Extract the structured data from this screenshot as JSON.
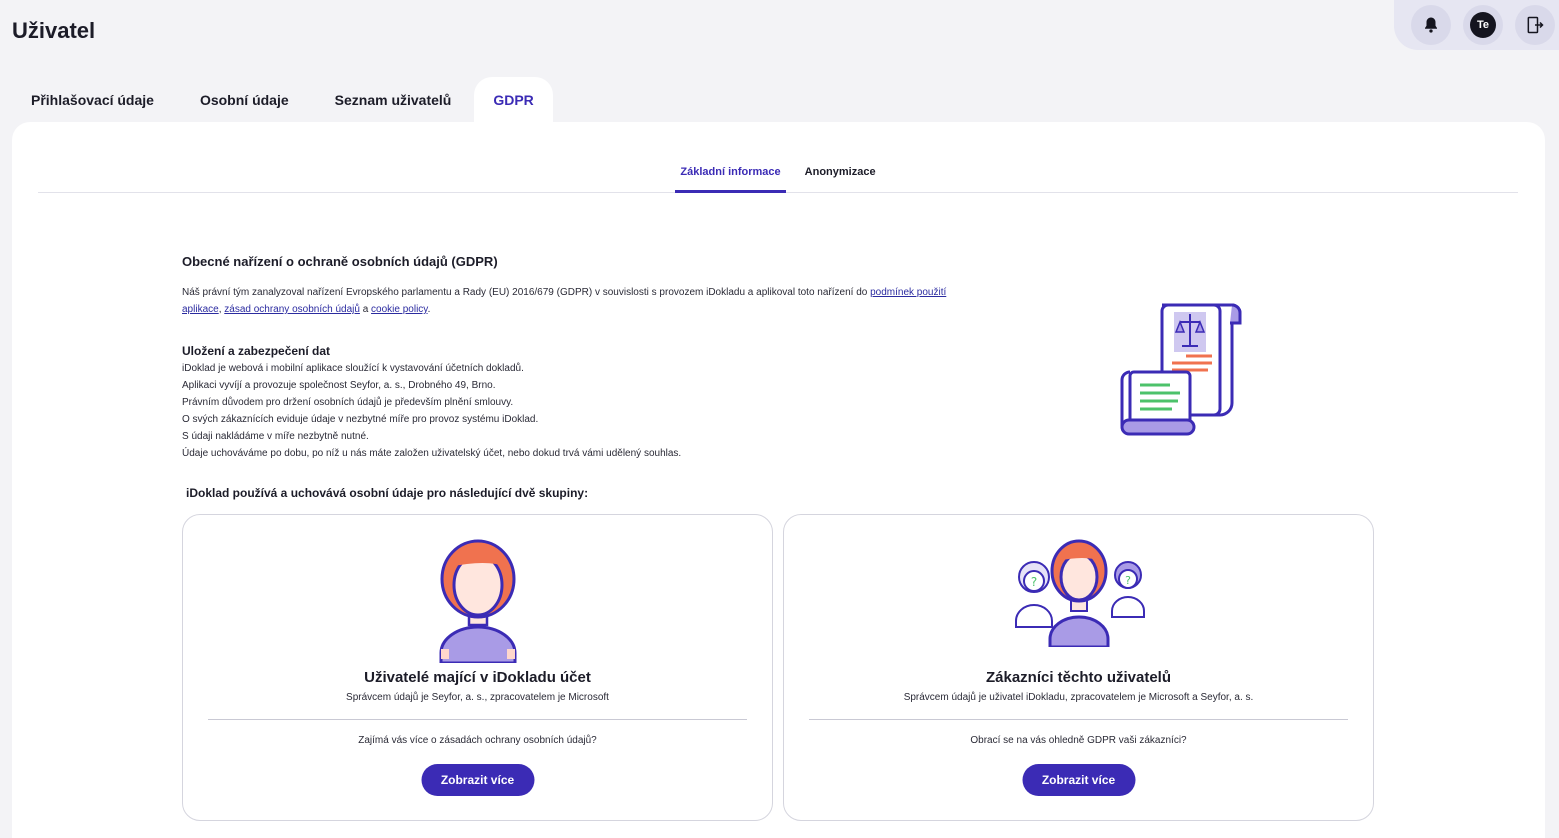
{
  "header": {
    "title": "Uživatel"
  },
  "topbar": {
    "avatar_initials": "Te",
    "icons": [
      "bell-icon",
      "avatar",
      "logout-icon"
    ]
  },
  "main_tabs": [
    {
      "label": "Přihlašovací údaje",
      "active": false
    },
    {
      "label": "Osobní údaje",
      "active": false
    },
    {
      "label": "Seznam uživatelů",
      "active": false
    },
    {
      "label": "GDPR",
      "active": true
    }
  ],
  "sub_tabs": [
    {
      "label": "Základní informace",
      "active": true
    },
    {
      "label": "Anonymizace",
      "active": false
    }
  ],
  "gdpr": {
    "title": "Obecné nařízení o ochraně osobních údajů (GDPR)",
    "intro_text": "Náš právní tým zanalyzoval nařízení Evropského parlamentu a Rady (EU) 2016/679 (GDPR) v souvislosti s provozem iDokladu a aplikoval toto nařízení do ",
    "link_terms": "podmínek použití aplikace",
    "sep1": ", ",
    "link_privacy": "zásad ochrany osobních údajů",
    "sep2": " a ",
    "link_cookie": "cookie policy",
    "end": "."
  },
  "storage": {
    "title": "Uložení a zabezpečení dat",
    "lines": [
      "iDoklad je webová i mobilní aplikace sloužící k vystavování účetních dokladů.",
      "Aplikaci vyvíjí a provozuje společnost Seyfor, a. s., Drobného 49, Brno.",
      "Právním důvodem pro držení osobních údajů je především plnění smlouvy.",
      "O svých zákaznících eviduje údaje v nezbytné míře pro provoz systému iDoklad.",
      "S údaji nakládáme v míře nezbytně nutné.",
      "Údaje uchováváme po dobu, po níž u nás máte založen uživatelský účet, nebo dokud trvá vámi udělený souhlas."
    ]
  },
  "groups": {
    "title": "iDoklad používá a uchovává osobní údaje pro následující dvě skupiny:",
    "cards": [
      {
        "title": "Uživatelé mající v iDokladu účet",
        "subtitle": "Správcem údajů je Seyfor, a. s., zpracovatelem je Microsoft",
        "question": "Zajímá vás více o zásadách ochrany osobních údajů?",
        "button": "Zobrazit více"
      },
      {
        "title": "Zákazníci těchto uživatelů",
        "subtitle": "Správcem údajů je uživatel iDokladu, zpracovatelem je Microsoft a Seyfor, a. s.",
        "question": "Obrací se na vás ohledně GDPR vaši zákazníci?",
        "button": "Zobrazit více"
      }
    ]
  },
  "colors": {
    "accent": "#3b2bb5",
    "illustration_purple": "#a99be6",
    "illustration_orange": "#f0724f"
  }
}
